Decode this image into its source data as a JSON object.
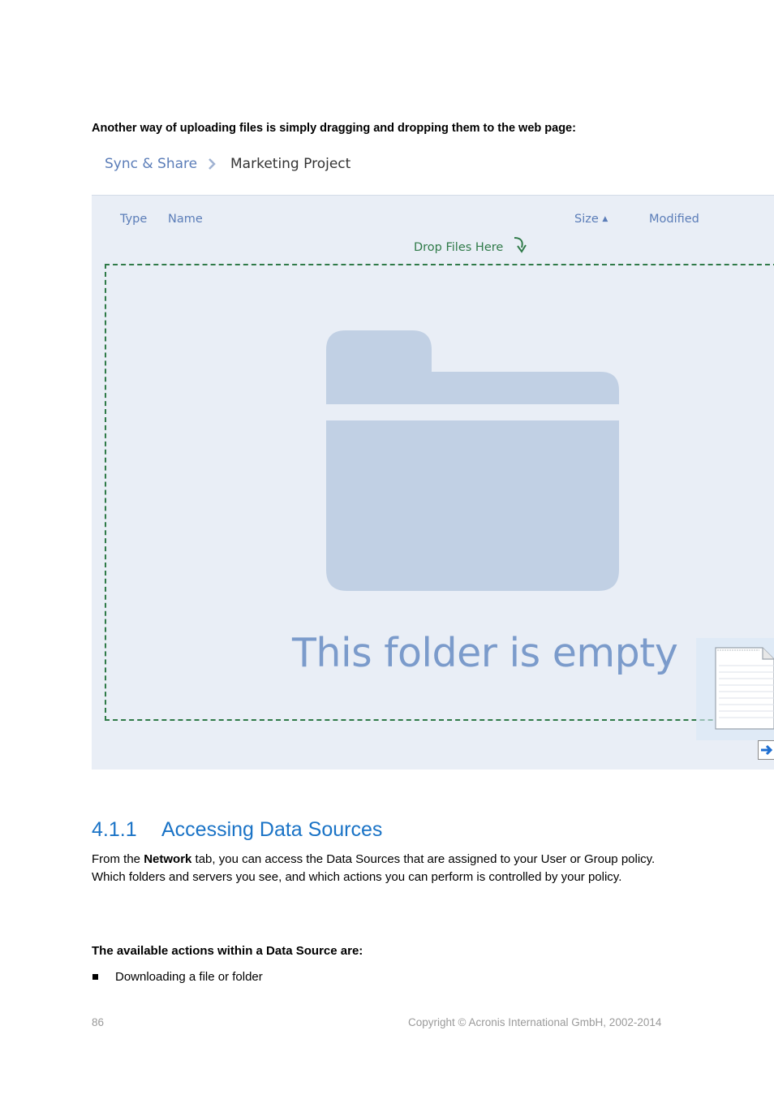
{
  "intro_text": "Another way of uploading files is simply dragging and dropping them to the web page:",
  "breadcrumb": {
    "root": "Sync & Share",
    "current": "Marketing Project"
  },
  "file_list": {
    "columns": {
      "type": "Type",
      "name": "Name",
      "size": "Size",
      "modified": "Modified"
    },
    "sort_indicator": "▲",
    "drop_label": "Drop Files Here",
    "empty_message": "This folder is empty"
  },
  "section": {
    "number": "4.1.1",
    "title": "Accessing Data Sources",
    "paragraph_before": "From the ",
    "paragraph_bold": "Network",
    "paragraph_after": " tab, you can access the Data Sources that are assigned to your User or Group policy. Which folders and servers you see, and which actions you can perform is controlled by your policy.",
    "actions_heading": "The available actions within a Data Source are:",
    "actions": [
      "Downloading a file or folder"
    ]
  },
  "footer": {
    "page_number": "86",
    "copyright": "Copyright © Acronis International GmbH, 2002-2014"
  },
  "colors": {
    "link_blue": "#5b7db8",
    "drop_green": "#2f7a48",
    "panel_bg": "#e9eef6",
    "folder_fill": "#c1d0e4",
    "heading_blue": "#1a73c6"
  }
}
